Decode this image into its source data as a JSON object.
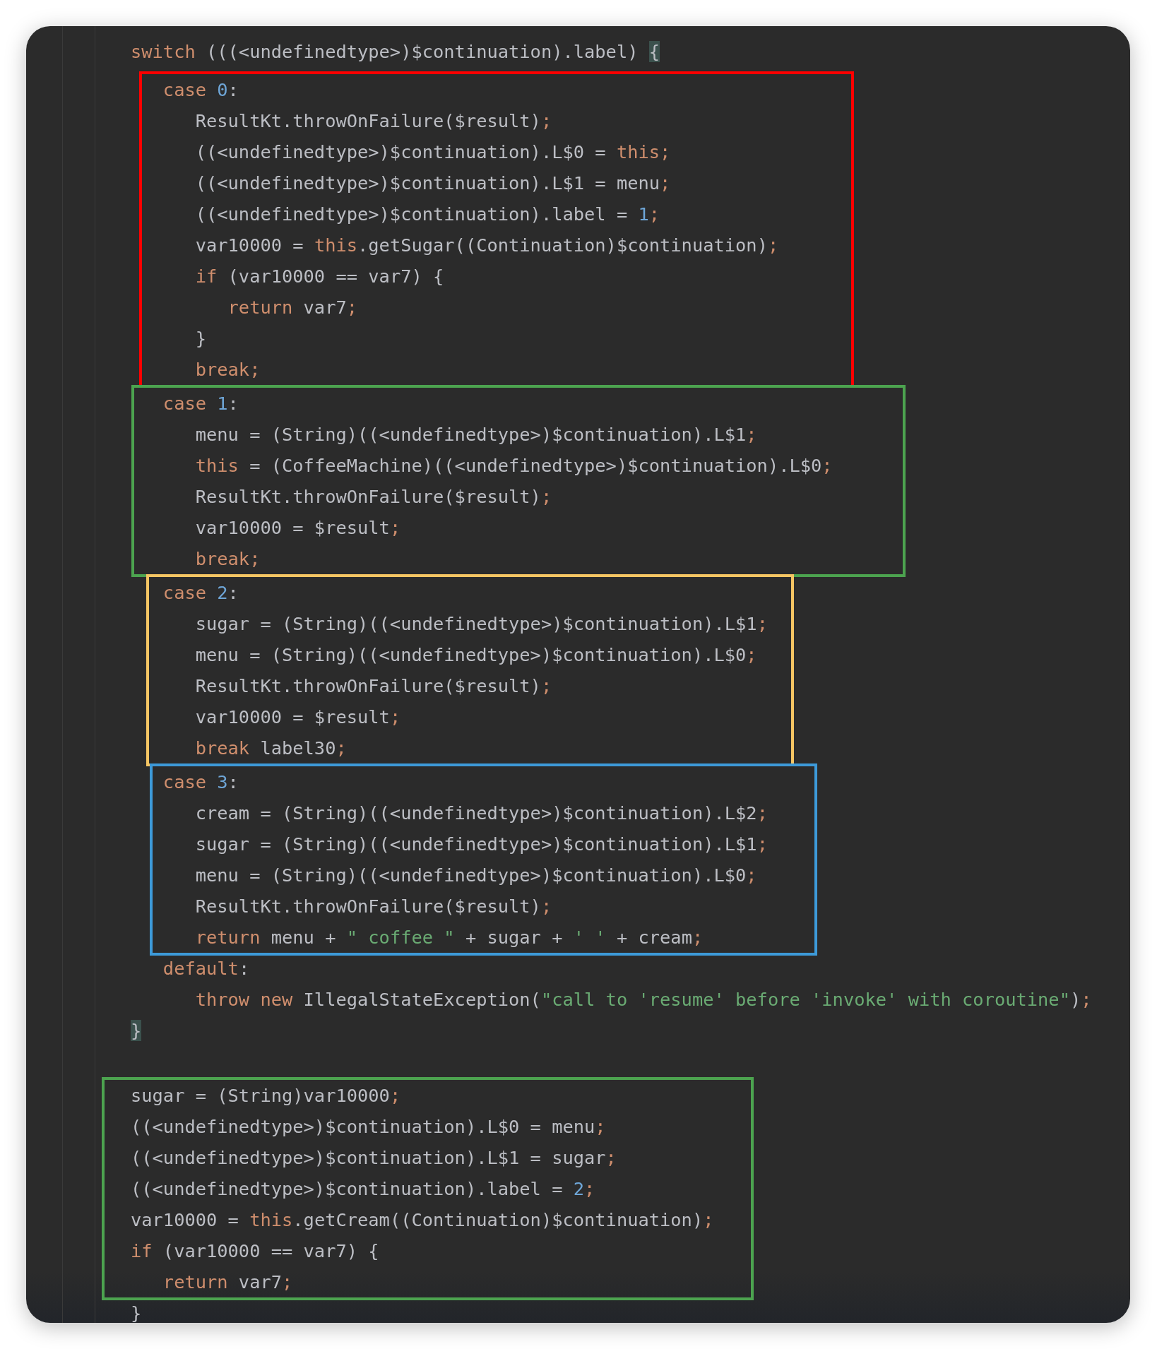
{
  "editor": {
    "blocks": [
      {
        "kind": "lines",
        "lines": [
          {
            "tokens": [
              {
                "t": "switch",
                "kind": "keyword"
              },
              {
                "t": " (((<undefinedtype>)$continuation).label) ",
                "kind": "plain"
              },
              {
                "t": "{",
                "kind": "brace"
              }
            ]
          }
        ]
      },
      {
        "kind": "box",
        "color": "#ff0000",
        "lines": [
          {
            "tokens": [
              {
                "t": "   case ",
                "kind": "keyword"
              },
              {
                "t": "0",
                "kind": "number"
              },
              {
                "t": ":",
                "kind": "plain"
              }
            ]
          },
          {
            "tokens": [
              {
                "t": "      ResultKt.throwOnFailure($result)",
                "kind": "plain"
              },
              {
                "t": ";",
                "kind": "keyword"
              }
            ]
          },
          {
            "tokens": [
              {
                "t": "      ((<undefinedtype>)$continuation).L$0 = ",
                "kind": "plain"
              },
              {
                "t": "this;",
                "kind": "keyword"
              }
            ]
          },
          {
            "tokens": [
              {
                "t": "      ((<undefinedtype>)$continuation).L$1 = menu",
                "kind": "plain"
              },
              {
                "t": ";",
                "kind": "keyword"
              }
            ]
          },
          {
            "tokens": [
              {
                "t": "      ((<undefinedtype>)$continuation).label = ",
                "kind": "plain"
              },
              {
                "t": "1",
                "kind": "number"
              },
              {
                "t": ";",
                "kind": "keyword"
              }
            ]
          },
          {
            "tokens": [
              {
                "t": "      var10000 = ",
                "kind": "plain"
              },
              {
                "t": "this",
                "kind": "keyword"
              },
              {
                "t": ".getSugar((Continuation)$continuation)",
                "kind": "plain"
              },
              {
                "t": ";",
                "kind": "keyword"
              }
            ]
          },
          {
            "tokens": [
              {
                "t": "      if",
                "kind": "keyword"
              },
              {
                "t": " (var10000 == var7) {",
                "kind": "plain"
              }
            ]
          },
          {
            "tokens": [
              {
                "t": "         return",
                "kind": "keyword"
              },
              {
                "t": " var7",
                "kind": "plain"
              },
              {
                "t": ";",
                "kind": "keyword"
              }
            ]
          },
          {
            "tokens": [
              {
                "t": "      }",
                "kind": "plain"
              }
            ]
          },
          {
            "tokens": [
              {
                "t": "      break;",
                "kind": "keyword"
              }
            ]
          }
        ]
      },
      {
        "kind": "box",
        "color": "#4ca34f",
        "lines": [
          {
            "tokens": [
              {
                "t": "   case ",
                "kind": "keyword"
              },
              {
                "t": "1",
                "kind": "number"
              },
              {
                "t": ":",
                "kind": "plain"
              }
            ]
          },
          {
            "tokens": [
              {
                "t": "      menu = (String)((<undefinedtype>)$continuation).L$1",
                "kind": "plain"
              },
              {
                "t": ";",
                "kind": "keyword"
              }
            ]
          },
          {
            "tokens": [
              {
                "t": "      this",
                "kind": "keyword"
              },
              {
                "t": " = (CoffeeMachine)((<undefinedtype>)$continuation).L$0",
                "kind": "plain"
              },
              {
                "t": ";",
                "kind": "keyword"
              }
            ]
          },
          {
            "tokens": [
              {
                "t": "      ResultKt.throwOnFailure($result)",
                "kind": "plain"
              },
              {
                "t": ";",
                "kind": "keyword"
              }
            ]
          },
          {
            "tokens": [
              {
                "t": "      var10000 = $result",
                "kind": "plain"
              },
              {
                "t": ";",
                "kind": "keyword"
              }
            ]
          },
          {
            "tokens": [
              {
                "t": "      break;",
                "kind": "keyword"
              }
            ]
          }
        ]
      },
      {
        "kind": "box",
        "color": "#f5c563",
        "lines": [
          {
            "tokens": [
              {
                "t": "   case ",
                "kind": "keyword"
              },
              {
                "t": "2",
                "kind": "number"
              },
              {
                "t": ":",
                "kind": "plain"
              }
            ]
          },
          {
            "tokens": [
              {
                "t": "      sugar = (String)((<undefinedtype>)$continuation).L$1",
                "kind": "plain"
              },
              {
                "t": ";",
                "kind": "keyword"
              }
            ]
          },
          {
            "tokens": [
              {
                "t": "      menu = (String)((<undefinedtype>)$continuation).L$0",
                "kind": "plain"
              },
              {
                "t": ";",
                "kind": "keyword"
              }
            ]
          },
          {
            "tokens": [
              {
                "t": "      ResultKt.throwOnFailure($result)",
                "kind": "plain"
              },
              {
                "t": ";",
                "kind": "keyword"
              }
            ]
          },
          {
            "tokens": [
              {
                "t": "      var10000 = $result",
                "kind": "plain"
              },
              {
                "t": ";",
                "kind": "keyword"
              }
            ]
          },
          {
            "tokens": [
              {
                "t": "      break",
                "kind": "keyword"
              },
              {
                "t": " label30",
                "kind": "plain"
              },
              {
                "t": ";",
                "kind": "keyword"
              }
            ]
          }
        ]
      },
      {
        "kind": "box",
        "color": "#3d9ad9",
        "lines": [
          {
            "tokens": [
              {
                "t": "   case ",
                "kind": "keyword"
              },
              {
                "t": "3",
                "kind": "number"
              },
              {
                "t": ":",
                "kind": "plain"
              }
            ]
          },
          {
            "tokens": [
              {
                "t": "      cream = (String)((<undefinedtype>)$continuation).L$2",
                "kind": "plain"
              },
              {
                "t": ";",
                "kind": "keyword"
              }
            ]
          },
          {
            "tokens": [
              {
                "t": "      sugar = (String)((<undefinedtype>)$continuation).L$1",
                "kind": "plain"
              },
              {
                "t": ";",
                "kind": "keyword"
              }
            ]
          },
          {
            "tokens": [
              {
                "t": "      menu = (String)((<undefinedtype>)$continuation).L$0",
                "kind": "plain"
              },
              {
                "t": ";",
                "kind": "keyword"
              }
            ]
          },
          {
            "tokens": [
              {
                "t": "      ResultKt.throwOnFailure($result)",
                "kind": "plain"
              },
              {
                "t": ";",
                "kind": "keyword"
              }
            ]
          },
          {
            "tokens": [
              {
                "t": "      return",
                "kind": "keyword"
              },
              {
                "t": " menu + ",
                "kind": "plain"
              },
              {
                "t": "\" coffee \"",
                "kind": "string"
              },
              {
                "t": " + sugar + ",
                "kind": "plain"
              },
              {
                "t": "' '",
                "kind": "string"
              },
              {
                "t": " + cream",
                "kind": "plain"
              },
              {
                "t": ";",
                "kind": "keyword"
              }
            ]
          }
        ]
      },
      {
        "kind": "lines",
        "lines": [
          {
            "tokens": [
              {
                "t": "   default",
                "kind": "keyword"
              },
              {
                "t": ":",
                "kind": "plain"
              }
            ]
          },
          {
            "tokens": [
              {
                "t": "      throw new",
                "kind": "keyword"
              },
              {
                "t": " IllegalStateException(",
                "kind": "plain"
              },
              {
                "t": "\"call to 'resume' before 'invoke' with coroutine\"",
                "kind": "string"
              },
              {
                "t": ")",
                "kind": "plain"
              },
              {
                "t": ";",
                "kind": "keyword"
              }
            ]
          },
          {
            "tokens": [
              {
                "t": "}",
                "kind": "brace"
              }
            ]
          }
        ]
      },
      {
        "kind": "box",
        "color": "#4ca34f",
        "lines": [
          {
            "tokens": [
              {
                "t": "sugar = (String)var10000",
                "kind": "plain"
              },
              {
                "t": ";",
                "kind": "keyword"
              }
            ]
          },
          {
            "tokens": [
              {
                "t": "((<undefinedtype>)$continuation).L$0 = menu",
                "kind": "plain"
              },
              {
                "t": ";",
                "kind": "keyword"
              }
            ]
          },
          {
            "tokens": [
              {
                "t": "((<undefinedtype>)$continuation).L$1 = sugar",
                "kind": "plain"
              },
              {
                "t": ";",
                "kind": "keyword"
              }
            ]
          },
          {
            "tokens": [
              {
                "t": "((<undefinedtype>)$continuation).label = ",
                "kind": "plain"
              },
              {
                "t": "2",
                "kind": "number"
              },
              {
                "t": ";",
                "kind": "keyword"
              }
            ]
          },
          {
            "tokens": [
              {
                "t": "var10000 = ",
                "kind": "plain"
              },
              {
                "t": "this",
                "kind": "keyword"
              },
              {
                "t": ".getCream((Continuation)$continuation)",
                "kind": "plain"
              },
              {
                "t": ";",
                "kind": "keyword"
              }
            ]
          },
          {
            "tokens": [
              {
                "t": "if",
                "kind": "keyword"
              },
              {
                "t": " (var10000 == var7) {",
                "kind": "plain"
              }
            ]
          },
          {
            "tokens": [
              {
                "t": "   return",
                "kind": "keyword"
              },
              {
                "t": " var7",
                "kind": "plain"
              },
              {
                "t": ";",
                "kind": "keyword"
              }
            ]
          }
        ]
      },
      {
        "kind": "lines",
        "lines": [
          {
            "tokens": [
              {
                "t": "}",
                "kind": "plain"
              }
            ]
          }
        ]
      }
    ]
  }
}
